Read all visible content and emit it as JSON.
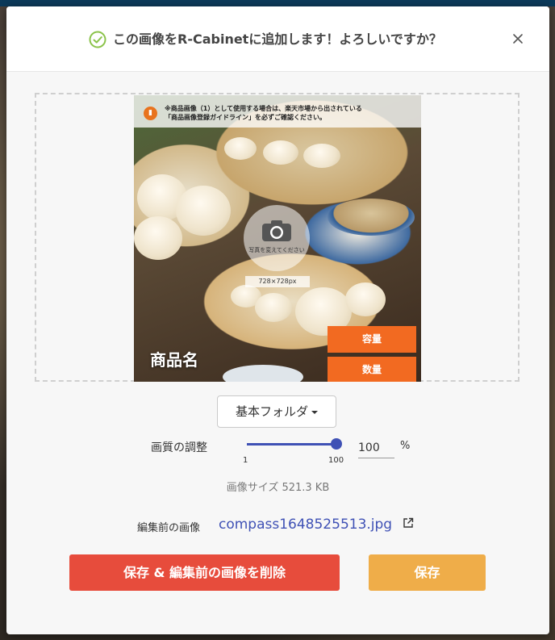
{
  "dialog": {
    "title": "この画像をR-Cabinetに追加します！よろしいですか？",
    "close_label": "×"
  },
  "preview": {
    "notice_line1": "※商品画像（1）として使用する場合は、楽天市場から出されている",
    "notice_line2": "「商品画像登録ガイドライン」を必ずご確認ください。",
    "camera_text": "写真を変えてください",
    "size_label": "728×728px",
    "tag_capacity": "容量",
    "tag_quantity": "数量",
    "product_name": "商品名"
  },
  "folder": {
    "label": "基本フォルダ"
  },
  "quality": {
    "label": "画質の調整",
    "value": "100",
    "min": "1",
    "max": "100",
    "unit": "%",
    "slider_level": 1.0
  },
  "file": {
    "size_text": "画像サイズ 521.3 KB",
    "original_label": "編集前の画像",
    "original_name": "compass1648525513.jpg"
  },
  "buttons": {
    "delete_save": "保存 & 編集前の画像を削除",
    "save": "保存"
  },
  "colors": {
    "accent": "#3f51b5",
    "delete": "#e74c3c",
    "save": "#efad49",
    "tag": "#f26a21",
    "success": "#8bc34a"
  }
}
